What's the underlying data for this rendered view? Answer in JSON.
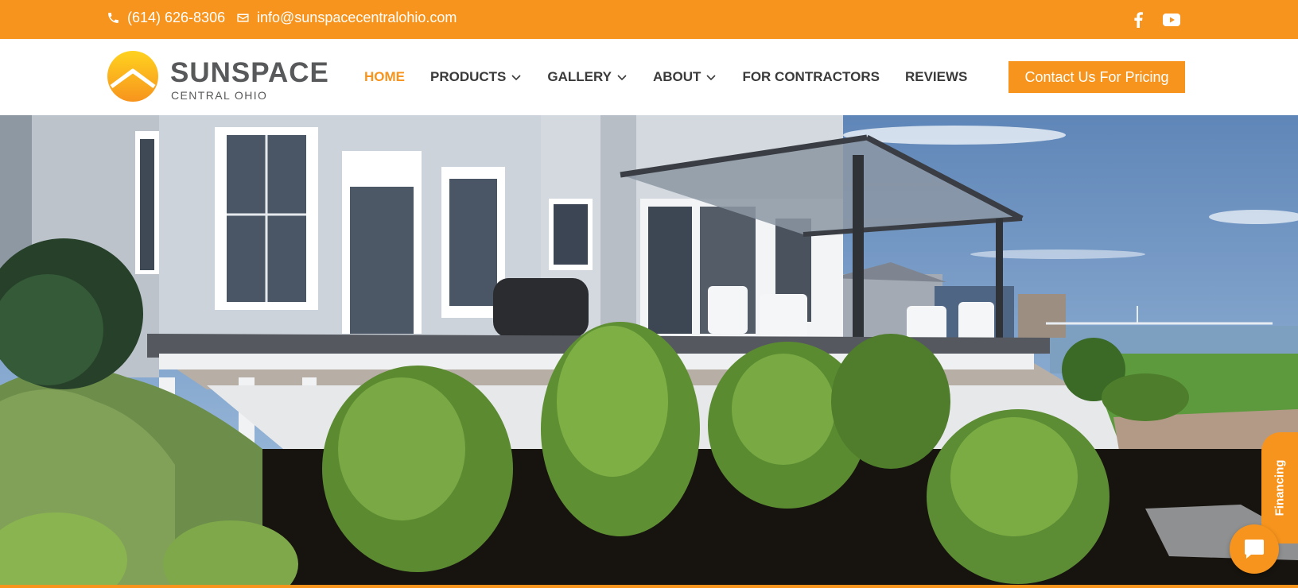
{
  "topbar": {
    "phone": "(614) 626-8306",
    "email": "info@sunspacecentralohio.com",
    "phone_icon": "phone-icon",
    "email_icon": "envelope-icon",
    "social": [
      {
        "icon": "facebook-icon"
      },
      {
        "icon": "youtube-icon"
      }
    ]
  },
  "logo": {
    "name": "SUNSPACE",
    "sub": "CENTRAL OHIO"
  },
  "nav": {
    "items": [
      {
        "label": "HOME",
        "active": true
      },
      {
        "label": "PRODUCTS",
        "dropdown": true
      },
      {
        "label": "GALLERY",
        "dropdown": true
      },
      {
        "label": "ABOUT",
        "dropdown": true
      },
      {
        "label": "FOR CONTRACTORS"
      },
      {
        "label": "REVIEWS"
      }
    ]
  },
  "cta": {
    "label": "Contact Us For Pricing"
  },
  "financing": {
    "label": "Financing"
  },
  "chat": {
    "icon": "chat-bubble-icon"
  },
  "colors": {
    "brand": "#f7941d",
    "text": "#3a3a3a",
    "logo_gray": "#58595b"
  }
}
